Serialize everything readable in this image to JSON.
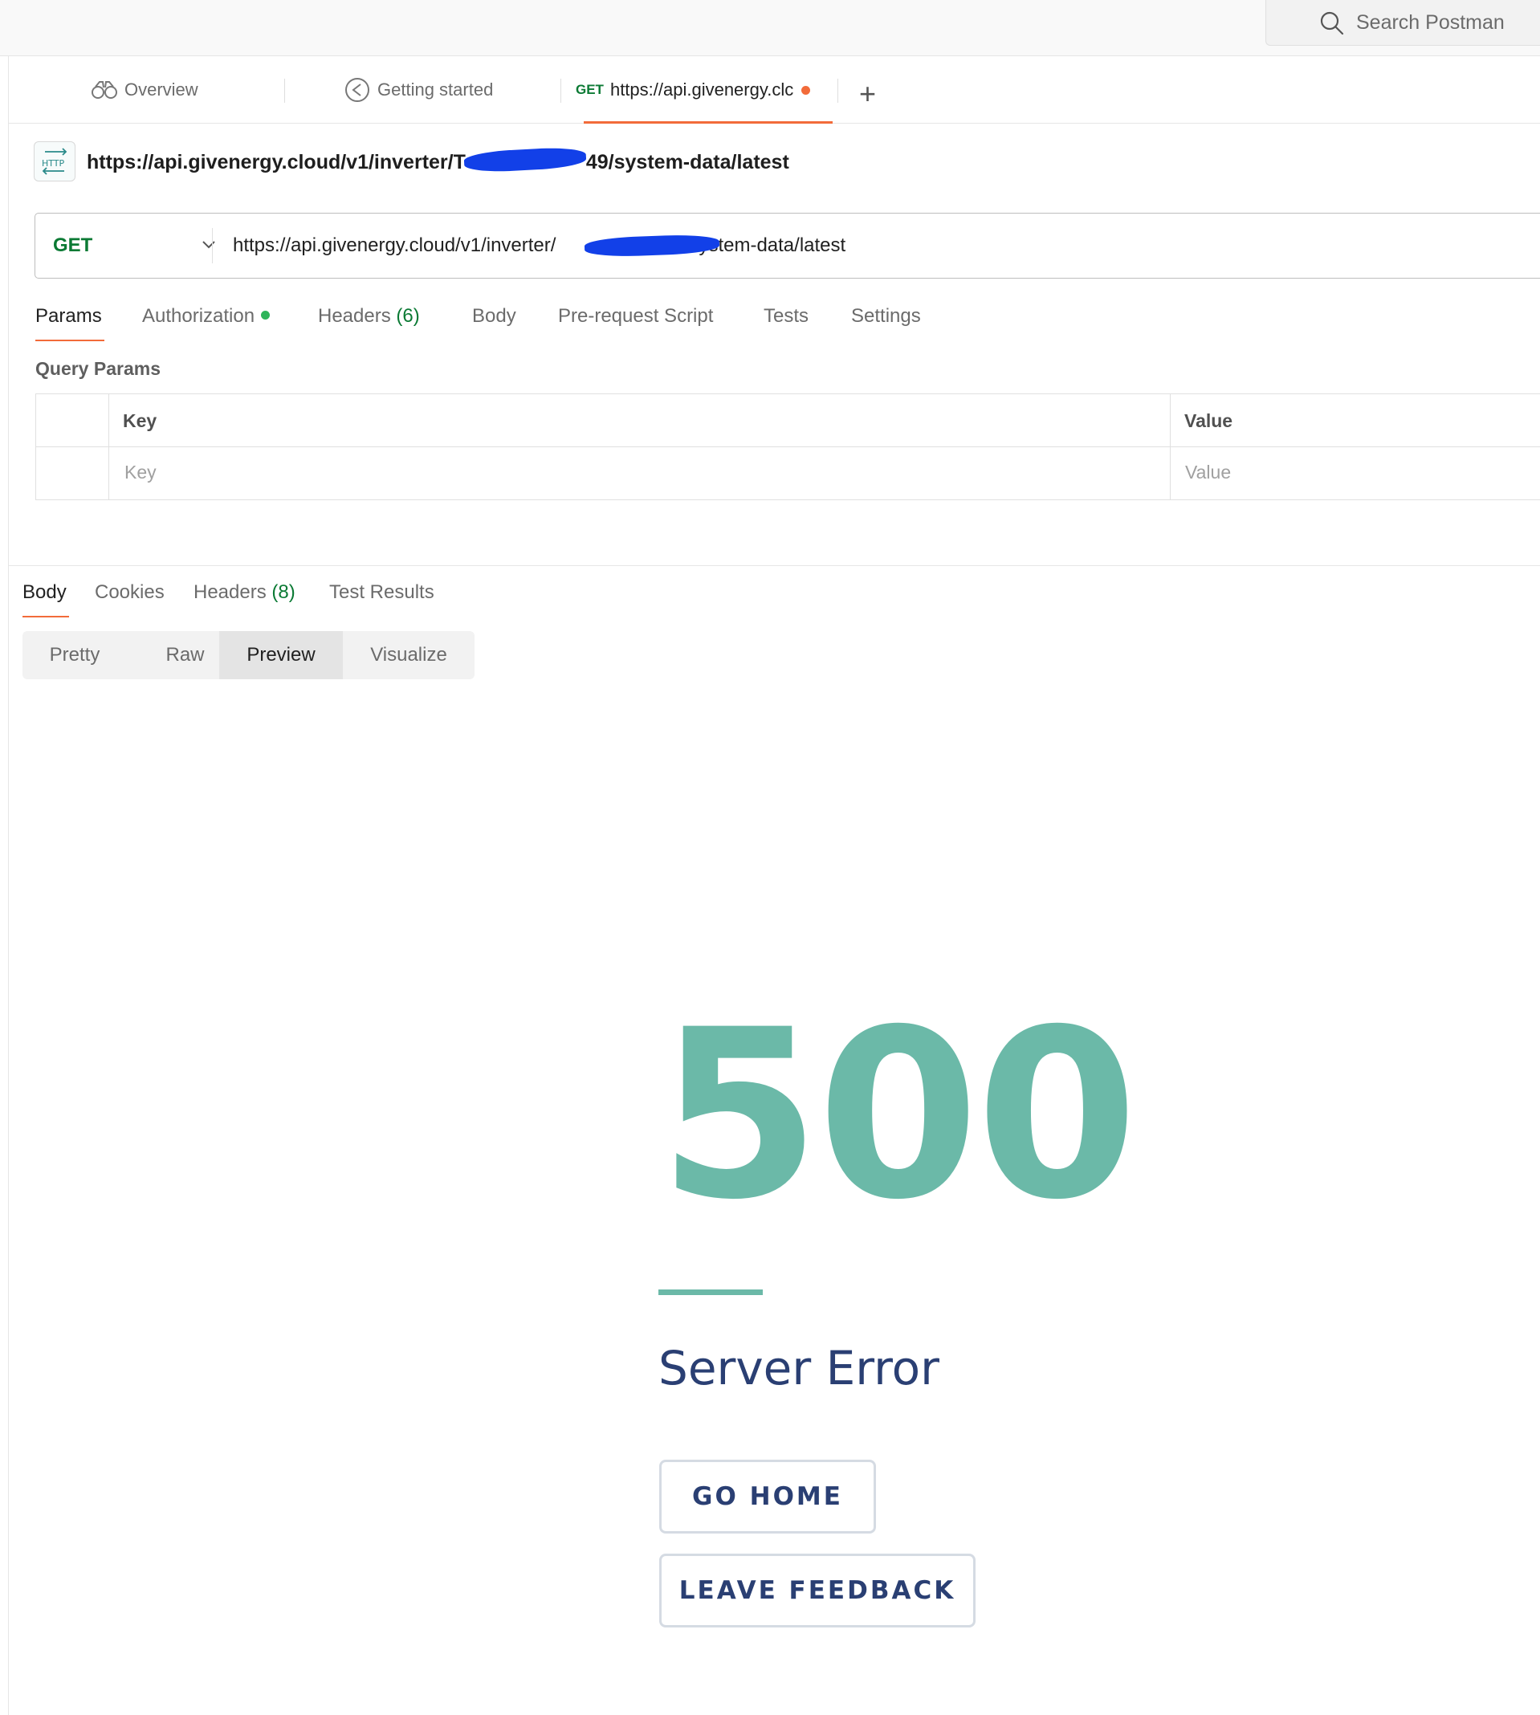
{
  "search": {
    "placeholder": "Search Postman"
  },
  "tabs": [
    {
      "label": "Overview"
    },
    {
      "label": "Getting started"
    },
    {
      "method": "GET",
      "label": "https://api.givenergy.clc"
    }
  ],
  "request": {
    "title_prefix": "https://api.givenergy.cloud/v1/inverter/T",
    "title_suffix": "49/system-data/latest",
    "badge": "HTTP",
    "method": "GET",
    "url_prefix": "https://api.givenergy.cloud/v1/inverter/",
    "url_suffix": "system-data/latest"
  },
  "request_tabs": {
    "params": "Params",
    "authorization": "Authorization",
    "headers": "Headers",
    "headers_count": "(6)",
    "body": "Body",
    "prerequest": "Pre-request Script",
    "tests": "Tests",
    "settings": "Settings"
  },
  "query_params": {
    "label": "Query Params",
    "key_header": "Key",
    "value_header": "Value",
    "key_placeholder": "Key",
    "value_placeholder": "Value"
  },
  "response_tabs": {
    "body": "Body",
    "cookies": "Cookies",
    "headers": "Headers",
    "headers_count": "(8)",
    "test_results": "Test Results"
  },
  "view_modes": [
    "Pretty",
    "Raw",
    "Preview",
    "Visualize"
  ],
  "preview": {
    "code": "500",
    "message": "Server Error",
    "go_home": "GO HOME",
    "leave_feedback": "LEAVE FEEDBACK"
  },
  "colors": {
    "accent_orange": "#f26b3a",
    "method_green": "#0b7a34",
    "error_teal": "#6bb9a8",
    "error_navy": "#2a3f73"
  }
}
